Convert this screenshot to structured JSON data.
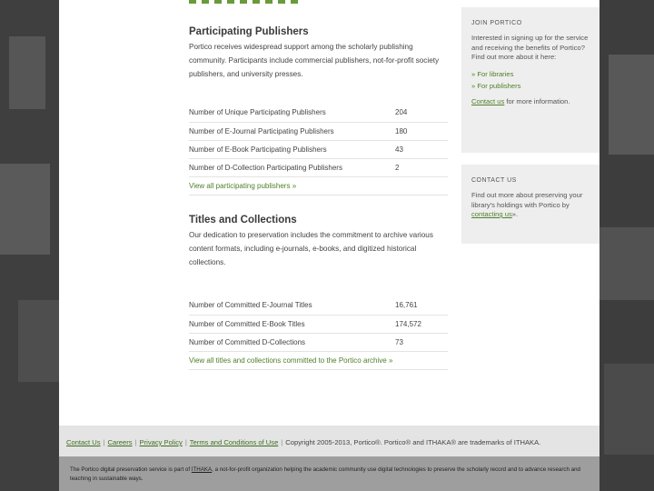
{
  "publishers": {
    "heading": "Participating Publishers",
    "intro": "Portico receives widespread support among the scholarly publishing community. Participants include commercial publishers, not-for-profit society publishers, and university presses.",
    "rows": [
      {
        "label": "Number of Unique Participating Publishers",
        "value": "204"
      },
      {
        "label": "Number of E-Journal Participating Publishers",
        "value": "180"
      },
      {
        "label": "Number of E-Book Participating Publishers",
        "value": "43"
      },
      {
        "label": "Number of D-Collection Participating Publishers",
        "value": "2"
      }
    ],
    "link": "View all participating publishers »"
  },
  "titles": {
    "heading": "Titles and Collections",
    "intro": "Our dedication to preservation includes the commitment to archive various content formats, including e-journals, e-books, and digitized historical collections.",
    "rows": [
      {
        "label": "Number of Committed E-Journal Titles",
        "value": "16,761"
      },
      {
        "label": "Number of Committed E-Book Titles",
        "value": "174,572"
      },
      {
        "label": "Number of Committed D-Collections",
        "value": "73"
      }
    ],
    "link": "View all titles and collections committed to the Portico archive »"
  },
  "join": {
    "heading": "JOIN PORTICO",
    "text": "Interested in signing up for the service and receiving the benefits of Portico? Find out more about it here:",
    "libraries_link": "» For libraries",
    "publishers_link": "» For publishers",
    "contact_pre": "",
    "contact_link": "Contact us",
    "contact_post": " for more information."
  },
  "contact": {
    "heading": "CONTACT US",
    "text": "Find out more about preserving your library's holdings with Portico by ",
    "link": "contacting us",
    "post": "»."
  },
  "footer": {
    "links": [
      "Contact Us",
      "Careers",
      "Privacy Policy",
      "Terms and Conditions of Use"
    ],
    "copyright": "Copyright 2005-2013, Portico®. Portico® and ITHAKA® are trademarks of ITHAKA."
  },
  "footer2": {
    "pre": "The Portico digital preservation service is part of ",
    "link": "ITHAKA",
    "post": ", a not-for-profit organization helping the academic community use digital technologies to preserve the scholarly record and to advance research and teaching in sustainable ways."
  }
}
